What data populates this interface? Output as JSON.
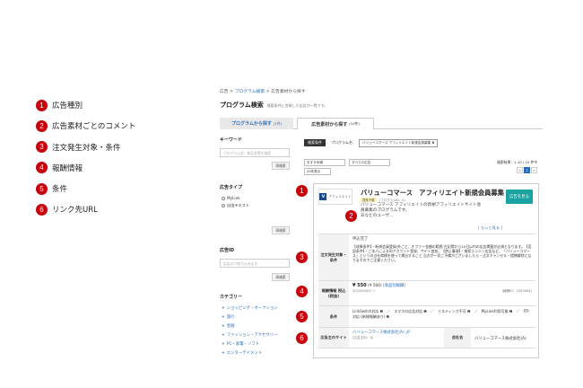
{
  "legend": [
    {
      "num": "1",
      "label": "広告種別"
    },
    {
      "num": "2",
      "label": "広告素材ごとのコメント"
    },
    {
      "num": "3",
      "label": "注文発生対象・条件"
    },
    {
      "num": "4",
      "label": "報酬情報"
    },
    {
      "num": "5",
      "label": "条件"
    },
    {
      "num": "6",
      "label": "リンク先URL"
    }
  ],
  "breadcrumb": {
    "root": "広告",
    "sep": ">",
    "link": "プログラム検索",
    "current": "広告素材から探す"
  },
  "page": {
    "title": "プログラム検索",
    "subtitle": "検索条件に合致した広告が一覧です。"
  },
  "tabs": [
    {
      "label": "プログラムから探す",
      "count": "(1件)"
    },
    {
      "label": "広告素材から探す",
      "count": "(10件)"
    }
  ],
  "sidebar": {
    "keyword": {
      "heading": "キーワード",
      "placeholder": "プログラム名、商品名等を検索",
      "button": "再検索"
    },
    "adtype": {
      "heading": "広告タイプ",
      "options": [
        "MyLink",
        "自由テキスト"
      ],
      "button": "再検索"
    },
    "adid": {
      "heading": "広告ID",
      "placeholder": "広告IDで絞り込みます",
      "button": "再検索"
    },
    "category": {
      "heading": "カテゴリー",
      "items": [
        "ショッピング・オークション",
        "旅行",
        "金融",
        "ファッション・アクセサリー",
        "PC・家電・ソフト",
        "エンターテイメント"
      ]
    }
  },
  "filter": {
    "chip": "検索条件",
    "label": "プログラム名：",
    "value": "バリューコマース アフィリエイト新規会員募集 ✖"
  },
  "sorts": {
    "sort1": "おすすめ順",
    "sort2": "すべての広告",
    "perpage": "20件表示"
  },
  "pageinfo": "検索結果：1-10 / 10 件中",
  "pager": [
    "<",
    "1",
    ">"
  ],
  "card": {
    "logo_text": "アフィリエイト",
    "title": "バリューコマース　アフィリエイト新規会員募集",
    "badge": "提携不要",
    "program_id": "(プログラムID：0)",
    "desc1": "バリューコマース アフィリエイトの新規アフィリエイトサイト会員募集のプログラムです。",
    "desc2": "あなたのユーザ...",
    "apply": "広告を見る",
    "more": "[ もっと見る ]",
    "cond_label": "注文発生対象・条件",
    "cond_head": "申込完了",
    "cond_text": "【成果条件】・新規会員登録(外ごと、オファー金額の範囲 左記際から15日以内の広告掲載が必須となります。【否認条件】・ご本人による同アカウント登録、サイト追加、【禁止事項】・検索エンジン広告など、「バリューコマース」というの当社商標を使って掲出すること 当方が一切ご不備がございましたら・注文キャンセル・提携解除となりますのでご注意ください。",
    "reward_label": "報酬情報 税込(税抜)",
    "reward_price": "¥ 550",
    "reward_tax": "(¥ 500)",
    "reward_link": "[商品別報酬]",
    "reward_date": "2023/04/03 ～",
    "reward_id": "(報酬ID：2349454)",
    "cond2_label": "条件",
    "cond2_items": "LinkSwitch対応 ❶　／　スマホの広告対応 ❶　／　リスティング不可 ❶　／　MyLink利用可能 ❶　／　ITP対応 (新規報酬あり) ❶",
    "site_label": "広告主のサイト",
    "site_link": "バリューコマース株式会社(A) 🔗",
    "site_sub": "(広告主ID：A)",
    "company_label": "会社名",
    "company_value": "バリューコマース株式会社(A)"
  },
  "markers": [
    "1",
    "2",
    "3",
    "4",
    "5",
    "6"
  ],
  "colors": {
    "marker": "#c7000b",
    "link": "#2a6ebb",
    "accent": "#1aa3a1"
  }
}
